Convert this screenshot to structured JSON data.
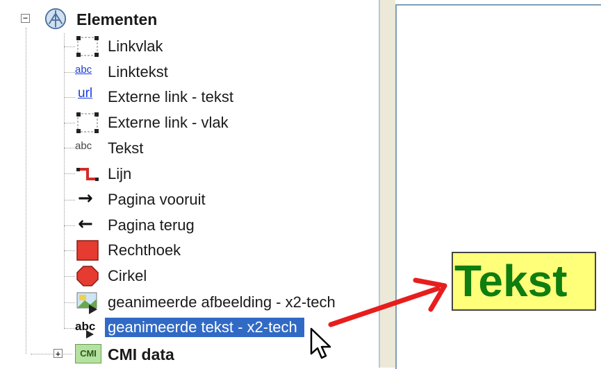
{
  "tree": {
    "root": {
      "label": "Elementen",
      "expander": "−",
      "icon": "elements-globe-icon"
    },
    "items": [
      {
        "label": "Linkvlak",
        "icon": "link-area-icon"
      },
      {
        "label": "Linktekst",
        "icon": "link-text-icon",
        "icon_text": "abc"
      },
      {
        "label": "Externe link - tekst",
        "icon": "external-link-text-icon",
        "icon_text": "url"
      },
      {
        "label": "Externe link - vlak",
        "icon": "external-link-area-icon"
      },
      {
        "label": "Tekst",
        "icon": "text-icon",
        "icon_text": "abc"
      },
      {
        "label": "Lijn",
        "icon": "line-icon"
      },
      {
        "label": "Pagina vooruit",
        "icon": "arrow-right-icon",
        "icon_text": "→"
      },
      {
        "label": "Pagina terug",
        "icon": "arrow-left-icon",
        "icon_text": "←"
      },
      {
        "label": "Rechthoek",
        "icon": "rectangle-icon"
      },
      {
        "label": "Cirkel",
        "icon": "circle-icon"
      },
      {
        "label": "geanimeerde afbeelding - x2-tech",
        "icon": "animated-image-icon"
      },
      {
        "label": "geanimeerde tekst - x2-tech",
        "icon": "animated-text-icon",
        "icon_text": "abc",
        "selected": true
      }
    ],
    "second_root": {
      "label": "CMI data",
      "expander": "+",
      "icon": "cmi-icon",
      "icon_text": "CMI"
    }
  },
  "canvas": {
    "text_element": "Tekst",
    "colors": {
      "text": "#0f7d0f",
      "background": "#ffff7a",
      "arrow": "#e81d1d"
    }
  },
  "colors": {
    "selection": "#316ac5",
    "link_blue": "#1b3dd6",
    "shape_red": "#e53b30"
  }
}
